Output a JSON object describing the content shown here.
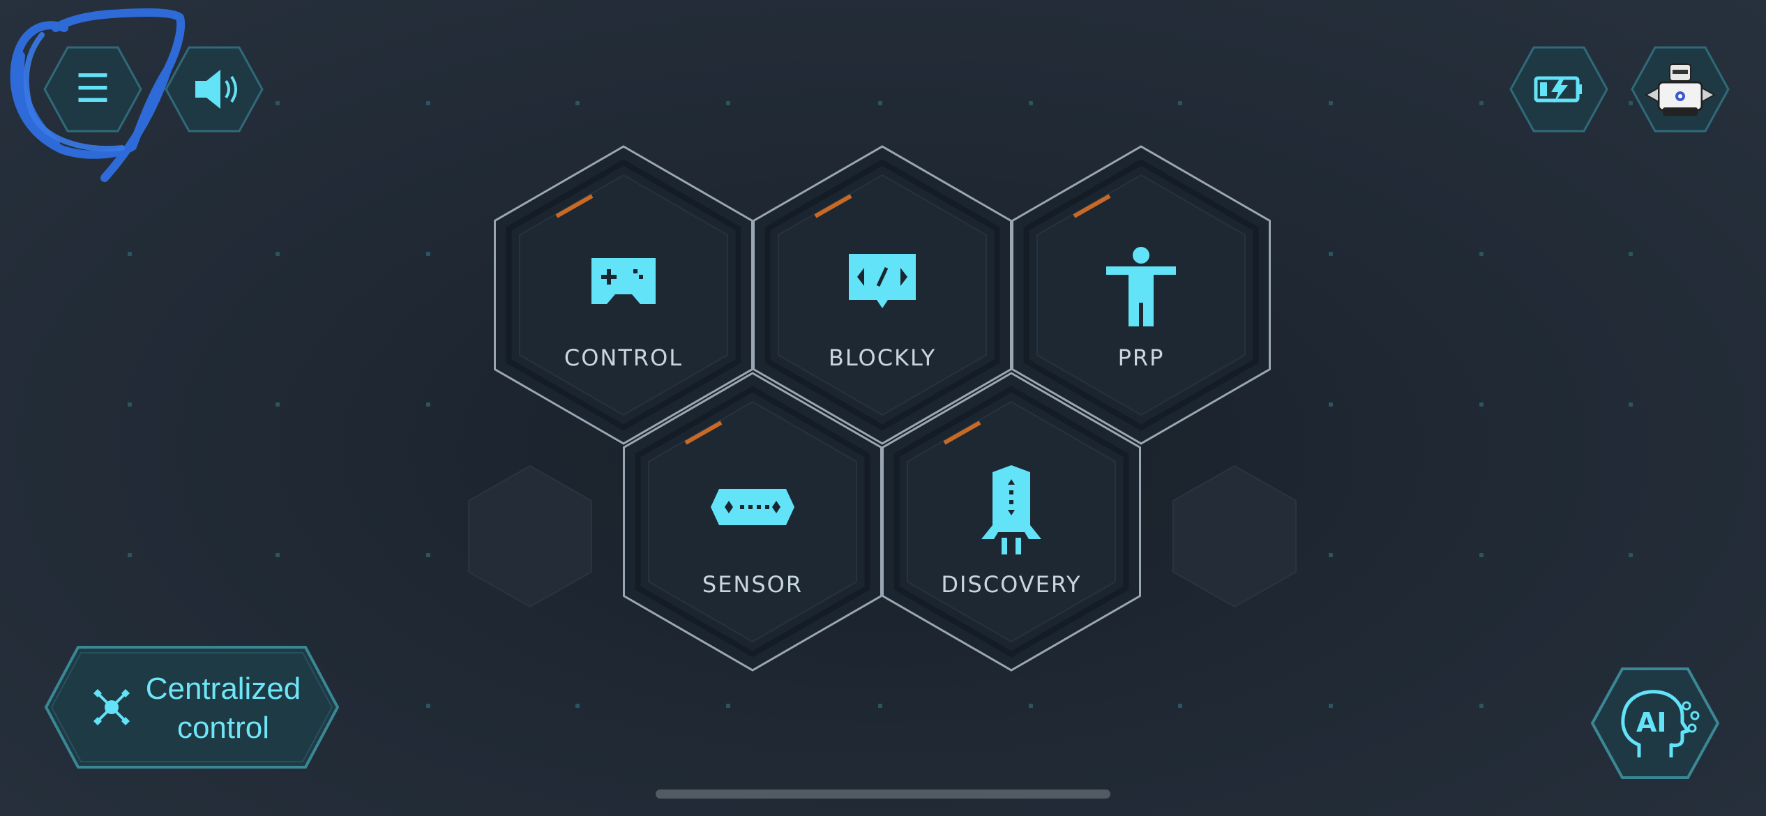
{
  "theme": {
    "accent": "#62e3f7",
    "tile_stroke": "#9aa7b3",
    "tile_fill": "#1b2530",
    "corner_accent": "#c86a26",
    "annotation": "#2f6fe0"
  },
  "top_bar": {
    "menu": {
      "icon": "hamburger-icon",
      "glyph": "☰"
    },
    "sound": {
      "icon": "speaker-icon"
    },
    "battery": {
      "icon": "battery-charging-icon"
    },
    "robot": {
      "icon": "robot-avatar"
    }
  },
  "modules": [
    {
      "id": "control",
      "label": "CONTROL",
      "icon": "gamepad-icon"
    },
    {
      "id": "blockly",
      "label": "BLOCKLY",
      "icon": "code-bubble-icon"
    },
    {
      "id": "prp",
      "label": "PRP",
      "icon": "person-icon"
    },
    {
      "id": "sensor",
      "label": "SENSOR",
      "icon": "sensor-icon"
    },
    {
      "id": "discovery",
      "label": "DISCOVERY",
      "icon": "rocket-icon"
    }
  ],
  "centralized_control": {
    "line1": "Centralized",
    "line2": "control",
    "icon": "drone-icon"
  },
  "ai_button": {
    "icon": "ai-head-icon",
    "text": "AI"
  }
}
